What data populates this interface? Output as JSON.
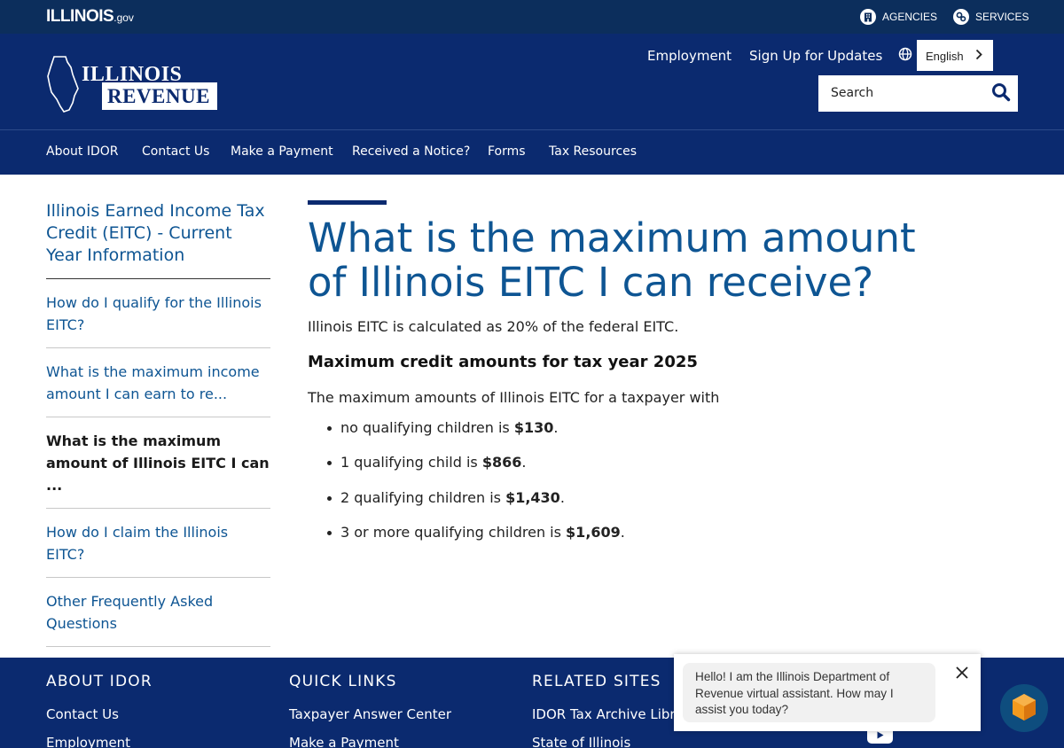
{
  "topbar": {
    "logo_main": "ILLINOIS",
    "logo_suffix": ".gov",
    "agencies": "AGENCIES",
    "services": "SERVICES"
  },
  "header": {
    "logo_line1": "ILLINOIS",
    "logo_line2": "REVENUE",
    "employment": "Employment",
    "signup": "Sign Up for Updates",
    "language": "English",
    "search_placeholder": "Search"
  },
  "nav": [
    "About IDOR",
    "Contact Us",
    "Make a Payment",
    "Received a Notice?",
    "Forms",
    "Tax Resources"
  ],
  "sidebar": {
    "title": "Illinois Earned Income Tax Credit (EITC) - Current Year Information",
    "items": [
      "How do I qualify for the Illinois EITC?",
      "What is the maximum income amount I can earn to re...",
      "What is the maximum amount of Illinois EITC I can ...",
      "How do I claim the Illinois EITC?",
      "Other Frequently Asked Questions"
    ]
  },
  "main": {
    "title": "What is the maximum amount of Illinois EITC I can receive?",
    "intro_para": "Illinois EITC is calculated as 20% of the federal EITC.",
    "subheading": "Maximum credit amounts for tax year 2025",
    "list_intro": "The maximum amounts of Illinois EITC for a taxpayer with",
    "bullets": [
      {
        "text": "no qualifying children is ",
        "amount": "$130",
        "end": "."
      },
      {
        "text": "1 qualifying child is ",
        "amount": "$866",
        "end": "."
      },
      {
        "text": "2 qualifying children is ",
        "amount": "$1,430",
        "end": "."
      },
      {
        "text": "3 or more qualifying children is ",
        "amount": "$1,609",
        "end": "."
      }
    ]
  },
  "footer": {
    "col1": {
      "heading": "ABOUT IDOR",
      "links": [
        "Contact Us",
        "Employment"
      ]
    },
    "col2": {
      "heading": "QUICK LINKS",
      "links": [
        "Taxpayer Answer Center",
        "Make a Payment"
      ]
    },
    "col3": {
      "heading": "RELATED SITES",
      "links": [
        "IDOR Tax Archive Library",
        "State of Illinois"
      ]
    }
  },
  "chat": {
    "message": "Hello! I am the Illinois Department of Revenue virtual assistant. How may I assist you today?"
  },
  "colors": {
    "top_bar": "#0c2e5c",
    "header_navy": "#0b2a6f",
    "link_blue": "#0e5593",
    "chat_launcher": "#0e4d7e",
    "chat_icon_orange": "#f39a1e"
  }
}
